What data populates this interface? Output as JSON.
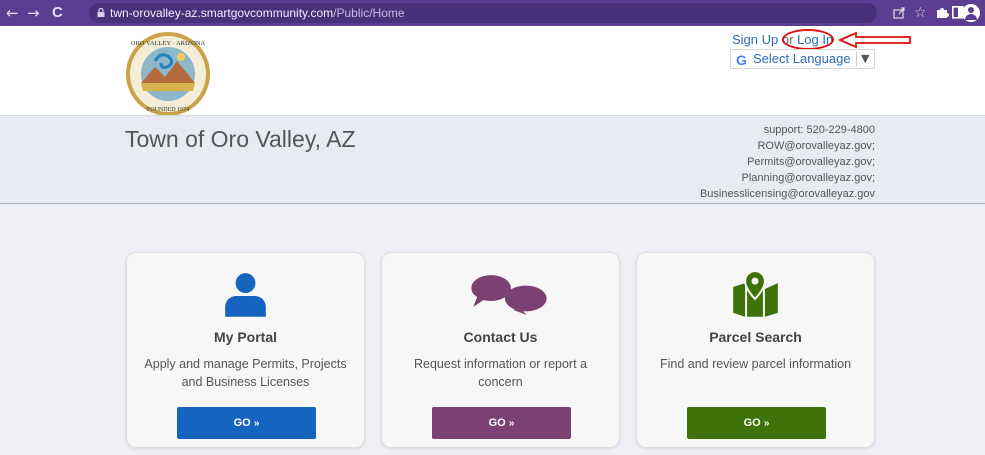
{
  "browser": {
    "url_host": "twn-orovalley-az.smartgovcommunity.com",
    "url_path": "/Public/Home",
    "nav_back": "←",
    "nav_forward": "→",
    "nav_reload": "C"
  },
  "header": {
    "signup_label": "Sign Up",
    "or_label": "or",
    "login_label": "Log In",
    "translate_label": "Select Language",
    "translate_arrow": "▼",
    "google_letter": "G",
    "site_title": "Town of Oro Valley, AZ",
    "contacts": [
      "support: 520-229-4800",
      "ROW@orovalleyaz.gov;",
      "Permits@orovalleyaz.gov;",
      "Planning@orovalleyaz.gov;",
      "Businesslicensing@orovalleyaz.gov"
    ]
  },
  "cards": [
    {
      "title": "My Portal",
      "desc": "Apply and manage Permits, Projects and Business Licenses",
      "button": "GO",
      "button_color": "#1565c0",
      "icon": "person-icon",
      "icon_color": "#1565c0"
    },
    {
      "title": "Contact Us",
      "desc": "Request information or report a concern",
      "button": "GO",
      "button_color": "#7b4173",
      "icon": "chat-bubbles-icon",
      "icon_color": "#7b4173"
    },
    {
      "title": "Parcel Search",
      "desc": "Find and review parcel information",
      "button": "GO",
      "button_color": "#3d7308",
      "icon": "map-pin-icon",
      "icon_color": "#3d7308"
    }
  ],
  "colors": {
    "browser_bar": "#5c3d91",
    "link": "#2d6cb5",
    "annotation_red": "#dd1111"
  }
}
